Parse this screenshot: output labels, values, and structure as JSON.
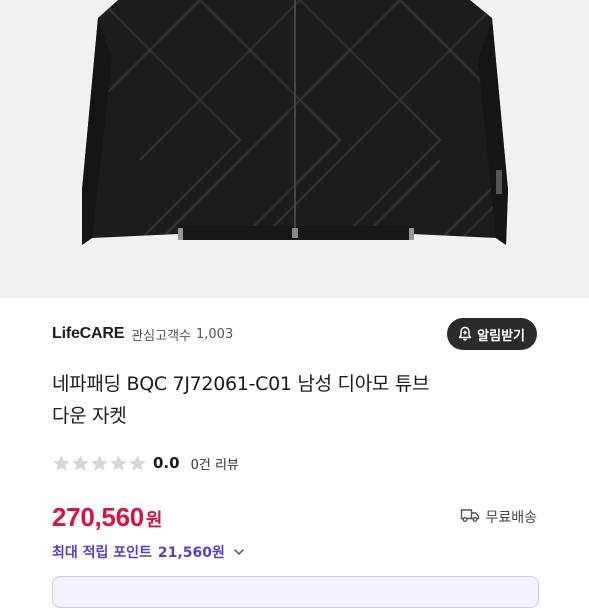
{
  "seller": {
    "name": "LifeCARE",
    "follower_label": "관심고객수",
    "follower_count": "1,003",
    "notify_label": "알림받기"
  },
  "product": {
    "title_line1": "네파패딩 BQC 7J72061-C01 남성 디아모 튜브",
    "title_line2": "다운 자켓",
    "rating": "0.0",
    "rating_stars": 0,
    "review_count": "0건 리뷰",
    "price": "270,560",
    "price_unit": "원",
    "shipping": "무료배송"
  },
  "points": {
    "label": "최대 적립 포인트",
    "value": "21,560원"
  },
  "icons": {
    "bell": "bell-plus-icon",
    "star": "star-icon",
    "truck": "truck-icon",
    "chevron": "chevron-down-icon"
  },
  "colors": {
    "price": "#d7143f",
    "points": "#5a3fc4",
    "button": "#2b2b2b",
    "star_empty": "#d6d6d6"
  }
}
